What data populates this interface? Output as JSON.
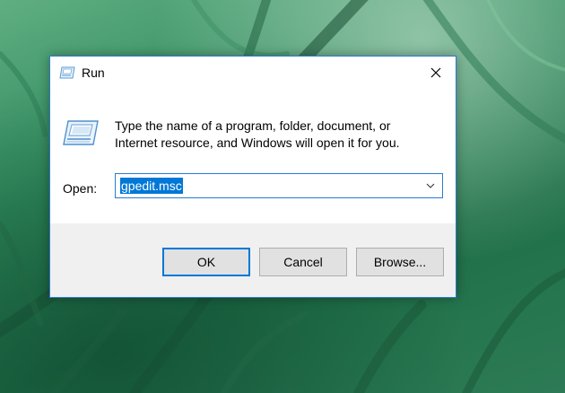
{
  "dialog": {
    "title": "Run",
    "description_line1": "Type the name of a program, folder, document, or",
    "description_line2": "Internet resource, and Windows will open it for you.",
    "open_label": "Open:",
    "input_value": "gpedit.msc",
    "buttons": {
      "ok": "OK",
      "cancel": "Cancel",
      "browse": "Browse..."
    }
  },
  "icons": {
    "title": "run-icon",
    "content": "run-icon",
    "close": "close-icon",
    "dropdown": "chevron-down-icon"
  },
  "colors": {
    "accent": "#0078d7",
    "dialog_border": "#2b7ad3",
    "footer_bg": "#f0f0f0",
    "button_bg": "#e1e1e1"
  }
}
